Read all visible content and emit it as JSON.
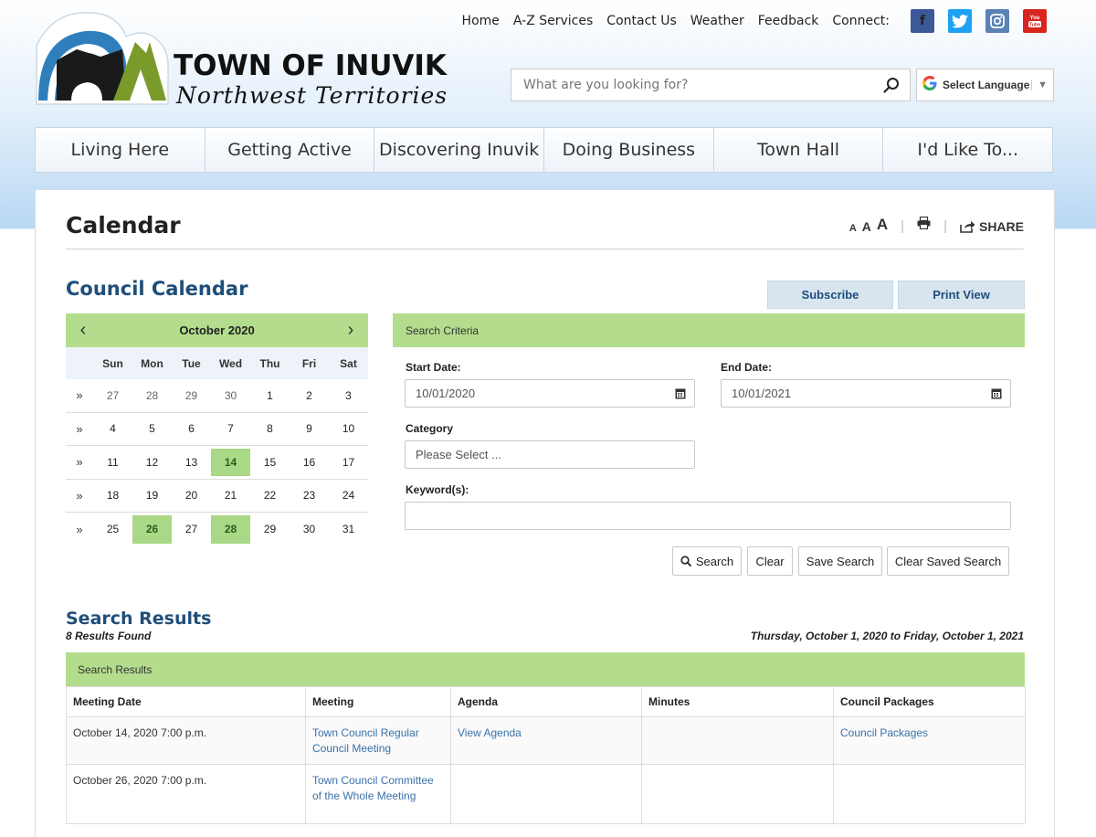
{
  "site": {
    "title": "TOWN OF INUVIK",
    "subtitle": "Northwest Territories"
  },
  "top_links": [
    "Home",
    "A-Z Services",
    "Contact Us",
    "Weather",
    "Feedback"
  ],
  "connect_label": "Connect:",
  "social": [
    {
      "name": "facebook",
      "glyph": "f",
      "color": "#3b5998"
    },
    {
      "name": "twitter",
      "glyph": "t",
      "color": "#1da1f2"
    },
    {
      "name": "instagram",
      "glyph": "◎",
      "color": "#5b82b5"
    },
    {
      "name": "youtube",
      "glyph": "▶",
      "color": "#d7261f"
    }
  ],
  "search": {
    "placeholder": "What are you looking for?"
  },
  "language": {
    "label": "Select Language"
  },
  "main_nav": [
    "Living Here",
    "Getting Active",
    "Discovering Inuvik",
    "Doing Business",
    "Town Hall",
    "I'd Like To..."
  ],
  "page": {
    "title": "Calendar",
    "font_sizes": [
      "A",
      "A",
      "A"
    ],
    "share_label": "SHARE"
  },
  "calendar_section": {
    "title": "Council Calendar",
    "subscribe_label": "Subscribe",
    "print_label": "Print View"
  },
  "calendar": {
    "month": "October 2020",
    "prev": "‹",
    "next": "›",
    "week_marker": "»",
    "days_of_week": [
      "Sun",
      "Mon",
      "Tue",
      "Wed",
      "Thu",
      "Fri",
      "Sat"
    ],
    "weeks": [
      [
        {
          "d": "27",
          "o": true
        },
        {
          "d": "28",
          "o": true
        },
        {
          "d": "29",
          "o": true
        },
        {
          "d": "30",
          "o": true
        },
        {
          "d": "1"
        },
        {
          "d": "2"
        },
        {
          "d": "3"
        }
      ],
      [
        {
          "d": "4"
        },
        {
          "d": "5"
        },
        {
          "d": "6"
        },
        {
          "d": "7"
        },
        {
          "d": "8"
        },
        {
          "d": "9"
        },
        {
          "d": "10"
        }
      ],
      [
        {
          "d": "11"
        },
        {
          "d": "12"
        },
        {
          "d": "13"
        },
        {
          "d": "14",
          "e": true
        },
        {
          "d": "15"
        },
        {
          "d": "16"
        },
        {
          "d": "17"
        }
      ],
      [
        {
          "d": "18"
        },
        {
          "d": "19"
        },
        {
          "d": "20"
        },
        {
          "d": "21"
        },
        {
          "d": "22"
        },
        {
          "d": "23"
        },
        {
          "d": "24"
        }
      ],
      [
        {
          "d": "25"
        },
        {
          "d": "26",
          "e": true
        },
        {
          "d": "27"
        },
        {
          "d": "28",
          "e": true
        },
        {
          "d": "29"
        },
        {
          "d": "30"
        },
        {
          "d": "31"
        }
      ]
    ]
  },
  "criteria": {
    "header": "Search Criteria",
    "start_label": "Start Date:",
    "start_value": "10/01/2020",
    "end_label": "End Date:",
    "end_value": "10/01/2021",
    "category_label": "Category",
    "category_value": "Please Select ...",
    "keywords_label": "Keyword(s):",
    "keywords_value": "",
    "buttons": {
      "search": "Search",
      "clear": "Clear",
      "save": "Save Search",
      "clear_saved": "Clear Saved Search"
    }
  },
  "results": {
    "title": "Search Results",
    "count": "8 Results Found",
    "range": "Thursday, October 1, 2020 to Friday, October 1, 2021",
    "header": "Search Results",
    "columns": [
      "Meeting Date",
      "Meeting",
      "Agenda",
      "Minutes",
      "Council Packages"
    ],
    "rows": [
      {
        "date": "October 14, 2020 7:00 p.m.",
        "meeting": "Town Council Regular Council Meeting",
        "agenda": "View Agenda",
        "minutes": "",
        "packages": "Council Packages"
      },
      {
        "date": "October 26, 2020 7:00 p.m.",
        "meeting": "Town Council Committee of the Whole Meeting",
        "agenda": "",
        "minutes": "",
        "packages": ""
      }
    ]
  }
}
